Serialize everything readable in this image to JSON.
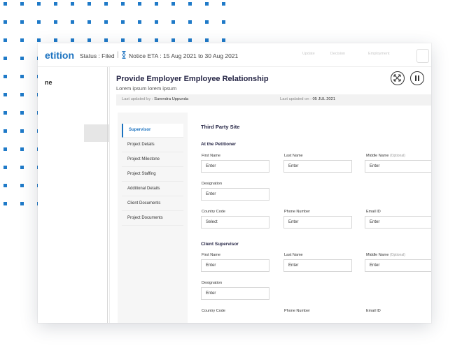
{
  "header": {
    "brand": "etition",
    "status": "Status : Filed",
    "separator": "|",
    "notice": "Notice  ETA : 15 Aug 2021 to 30 Aug 2021",
    "nav": [
      "Update",
      "Decision",
      "Employment"
    ]
  },
  "left_panel": {
    "title": "ne"
  },
  "panel": {
    "title": "Provide Employer Employee Relationship",
    "subtitle": "Lorem ipsum lorem ipsum",
    "updated_by_label": "Last updated by :",
    "updated_by_value": "Surendra Uppunda",
    "updated_on_label": "Last updated on :",
    "updated_on_value": "05 JUL 2021"
  },
  "tabs": [
    {
      "label": "Supervisor",
      "active": true
    },
    {
      "label": "Project Details",
      "active": false
    },
    {
      "label": "Project Milestone",
      "active": false
    },
    {
      "label": "Project Staffing",
      "active": false
    },
    {
      "label": "Additional Details",
      "active": false
    },
    {
      "label": "Client Documents",
      "active": false
    },
    {
      "label": "Project Documents",
      "active": false
    }
  ],
  "form": {
    "section_title": "Third Party Site",
    "petitioner": {
      "title": "At the Petitioner",
      "first_name_label": "First Name",
      "first_name_value": "Enter",
      "last_name_label": "Last Name",
      "last_name_value": "Enter",
      "middle_name_label": "Middle Name",
      "middle_name_optional": "(Optional)",
      "middle_name_value": "Enter",
      "designation_label": "Designation",
      "designation_value": "Enter",
      "country_code_label": "Country Code",
      "country_code_value": "Select",
      "phone_label": "Phone Number",
      "phone_value": "Enter",
      "email_label": "Email ID",
      "email_value": "Enter"
    },
    "client": {
      "title": "Client Supervisor",
      "first_name_label": "First Name",
      "first_name_value": "Enter",
      "last_name_label": "Last Name",
      "last_name_value": "Enter",
      "middle_name_label": "Middle Name",
      "middle_name_optional": "(Optional)",
      "middle_name_value": "Enter",
      "designation_label": "Designation",
      "designation_value": "Enter",
      "country_code_label": "Country Code",
      "phone_label": "Phone Number",
      "email_label": "Email ID"
    }
  },
  "icons": {
    "notice": "hourglass-icon",
    "expand": "expand-icon",
    "pause": "pause-icon"
  },
  "colors": {
    "accent": "#1b72c0",
    "dots": "#1f7ac8"
  }
}
